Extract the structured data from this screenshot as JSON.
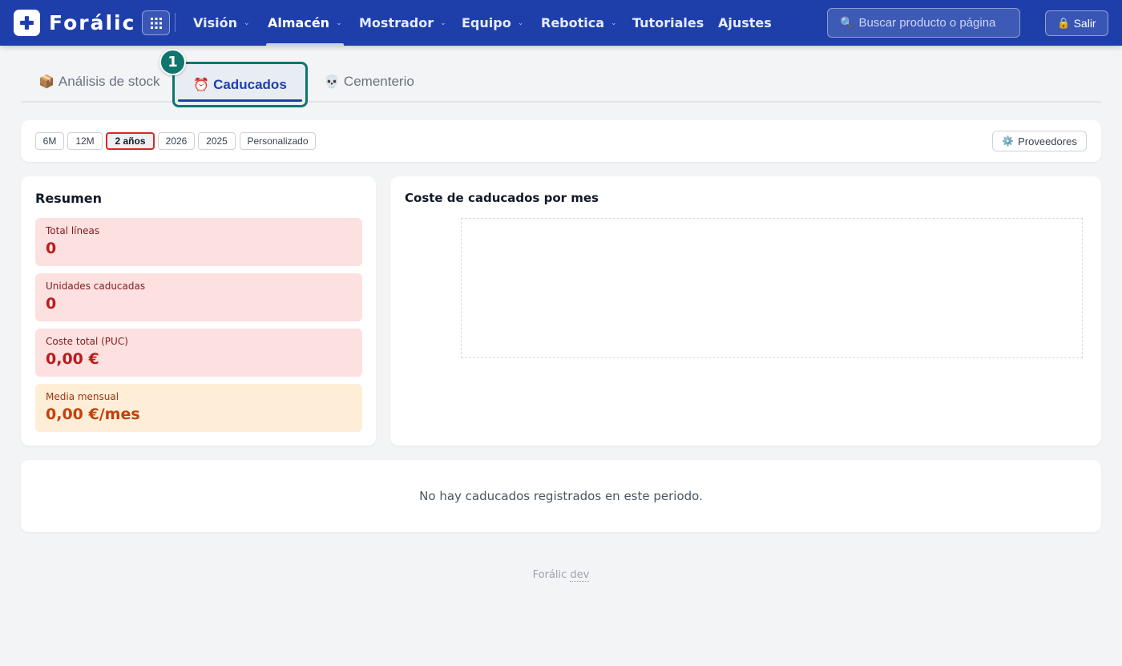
{
  "brand": {
    "name": "Forálic",
    "logo_icon": "plus-cross-icon",
    "color": "#1e3faa"
  },
  "nav": {
    "items": [
      {
        "label": "Visión",
        "dropdown": true,
        "active": false
      },
      {
        "label": "Almacén",
        "dropdown": true,
        "active": true
      },
      {
        "label": "Mostrador",
        "dropdown": true,
        "active": false
      },
      {
        "label": "Equipo",
        "dropdown": true,
        "active": false
      },
      {
        "label": "Rebotica",
        "dropdown": true,
        "active": false
      },
      {
        "label": "Tutoriales",
        "dropdown": false,
        "active": false
      },
      {
        "label": "Ajustes",
        "dropdown": false,
        "active": false
      }
    ],
    "chevron": "⌄",
    "search": {
      "icon": "🔍",
      "placeholder": "Buscar producto o página",
      "value": ""
    },
    "logout": {
      "icon": "🔒",
      "label": "Salir"
    }
  },
  "tabs": [
    {
      "icon": "📦",
      "label": "Análisis de stock",
      "active": false
    },
    {
      "icon": "⏰",
      "label": "Caducados",
      "active": true
    },
    {
      "icon": "💀",
      "label": "Cementerio",
      "active": false
    }
  ],
  "step_badge": "1",
  "filters": {
    "periods": [
      {
        "label": "6M",
        "selected": false
      },
      {
        "label": "12M",
        "selected": false
      },
      {
        "label": "2 años",
        "selected": true
      },
      {
        "label": "2026",
        "selected": false
      },
      {
        "label": "2025",
        "selected": false
      },
      {
        "label": "Personalizado",
        "selected": false
      }
    ],
    "providers_button": {
      "icon": "⚙️",
      "label": "Proveedores"
    }
  },
  "summary": {
    "title": "Resumen",
    "stats": [
      {
        "label": "Total líneas",
        "value": "0",
        "tone": "red"
      },
      {
        "label": "Unidades caducadas",
        "value": "0",
        "tone": "red"
      },
      {
        "label": "Coste total (PUC)",
        "value": "0,00 €",
        "tone": "red"
      },
      {
        "label": "Media mensual",
        "value": "0,00 €/mes",
        "tone": "amber"
      }
    ]
  },
  "chart": {
    "title": "Coste de caducados por mes"
  },
  "empty_message": "No hay caducados registrados en este periodo.",
  "footer": {
    "brand": "Forálic",
    "env": "dev"
  }
}
